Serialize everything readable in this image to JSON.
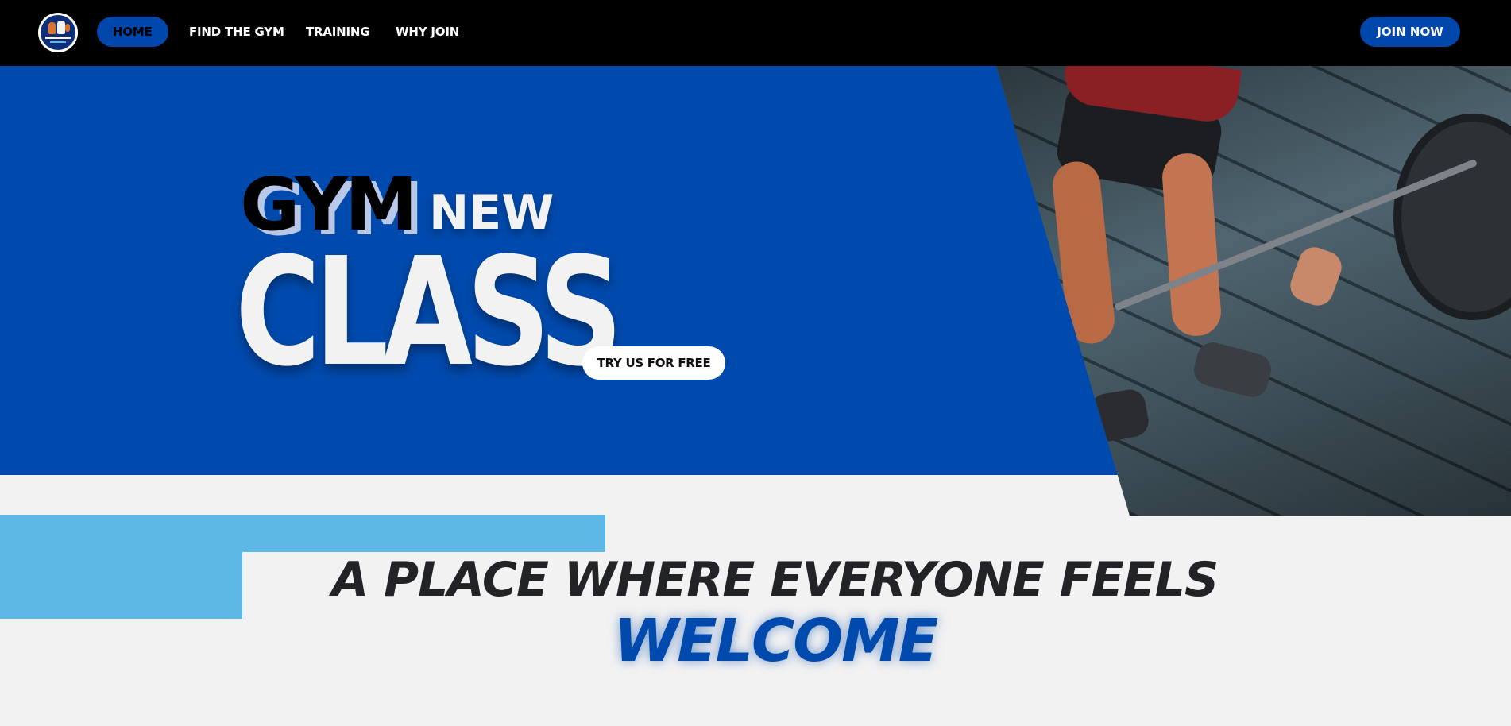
{
  "brand": {
    "logo_icon": "gym-logo-icon"
  },
  "nav": {
    "items": [
      {
        "label": "HOME",
        "active": true
      },
      {
        "label": "FIND THE GYM",
        "active": false
      },
      {
        "label": "TRAINING",
        "active": false
      },
      {
        "label": "WHY JOIN",
        "active": false
      }
    ],
    "cta_label": "JOIN NOW"
  },
  "hero": {
    "title_word_1": "GYM",
    "title_word_2": "NEW",
    "title_word_3": "CLASS",
    "cta_label": "TRY US FOR FREE",
    "image": "deadlift-photo"
  },
  "welcome": {
    "line_1": "A PLACE WHERE EVERYONE FEELS",
    "line_2": "WELCOME"
  },
  "colors": {
    "primary_blue": "#004aad",
    "accent_light_blue": "#5db8e6",
    "navbar_bg": "#000000",
    "page_bg": "#f2f2f2"
  }
}
